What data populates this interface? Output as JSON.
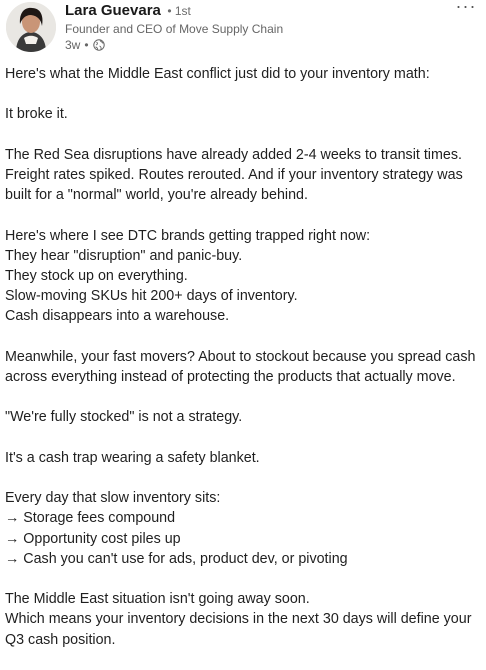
{
  "author": {
    "name": "Lara Guevara",
    "degree": "• 1st",
    "headline": "Founder and CEO of Move Supply Chain",
    "time": "3w",
    "visibility_icon": "globe-icon",
    "avatar_icon": "profile-photo"
  },
  "menu": {
    "more_label": "···"
  },
  "post": {
    "paragraphs": [
      [
        "Here's what the Middle East conflict just did to your inventory math:"
      ],
      [
        "It broke it."
      ],
      [
        "The Red Sea disruptions have already added 2-4 weeks to transit times.",
        "Freight rates spiked. Routes rerouted. And if your inventory strategy was",
        "built for a \"normal\" world, you're already behind."
      ],
      [
        "Here's where I see DTC brands getting trapped right now:",
        "They hear \"disruption\" and panic-buy.",
        "They stock up on everything.",
        "Slow-moving SKUs hit 200+ days of inventory.",
        "Cash disappears into a warehouse."
      ],
      [
        "Meanwhile, your fast movers? About to stockout because you spread cash",
        "across everything instead of protecting the products that actually move."
      ],
      [
        "\"We're fully stocked\" is not a strategy."
      ],
      [
        "It's a cash trap wearing a safety blanket."
      ],
      [
        "Every day that slow inventory sits:",
        "→ Storage fees compound",
        "→ Opportunity cost piles up",
        "→ Cash you can't use for ads, product dev, or pivoting"
      ],
      [
        "The Middle East situation isn't going away soon.",
        "Which means your inventory decisions in the next 30 days will define your",
        "Q3 cash position."
      ]
    ]
  }
}
